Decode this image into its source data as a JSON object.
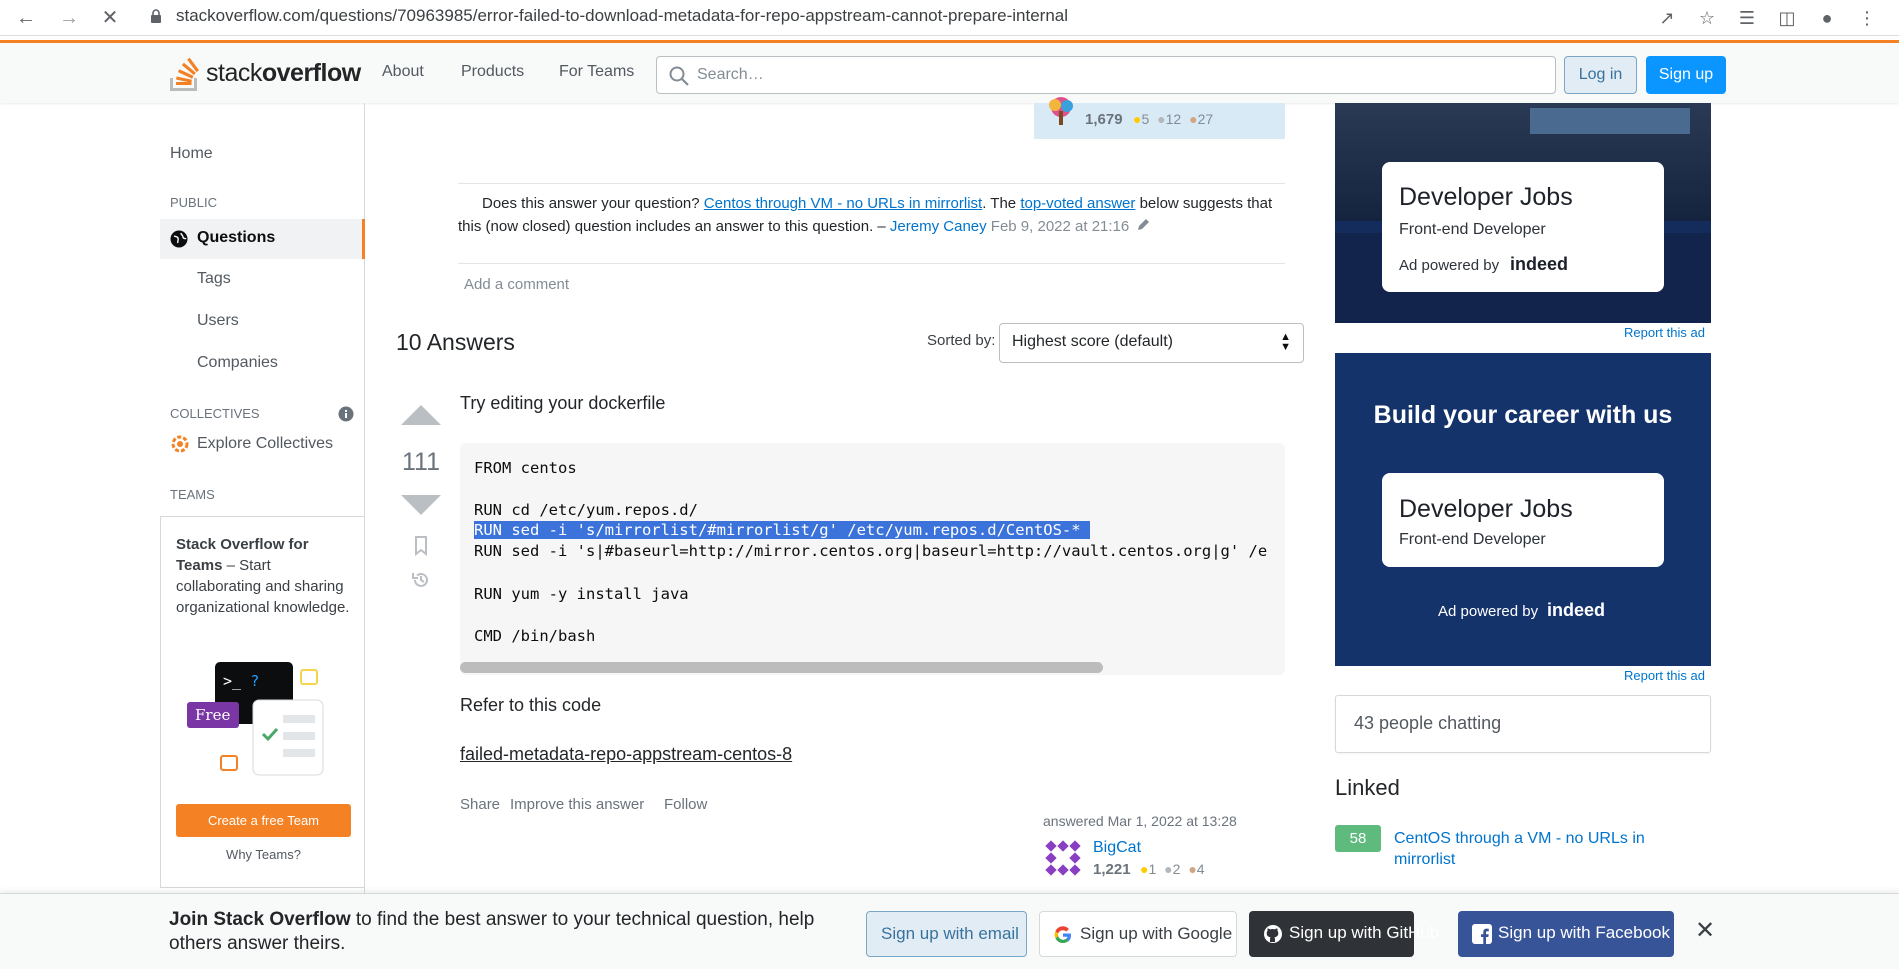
{
  "browser": {
    "url": "stackoverflow.com/questions/70963985/error-failed-to-download-metadata-for-repo-appstream-cannot-prepare-internal"
  },
  "header": {
    "logo_light": "stack",
    "logo_bold": "overflow",
    "nav": [
      "About",
      "Products",
      "For Teams"
    ],
    "search_placeholder": "Search…",
    "login": "Log in",
    "signup": "Sign up"
  },
  "sidebar": {
    "home": "Home",
    "public": "PUBLIC",
    "questions": "Questions",
    "tags": "Tags",
    "users": "Users",
    "companies": "Companies",
    "collectives": "COLLECTIVES",
    "explore_collectives": "Explore Collectives",
    "teams": "TEAMS",
    "teams_box": {
      "title": "Stack Overflow for Teams",
      "text": " – Start collaborating and sharing organizational knowledge.",
      "free_badge": "Free",
      "create_button": "Create a free Team",
      "why": "Why Teams?"
    }
  },
  "question_owner": {
    "rep": "1,679",
    "gold": "5",
    "silver": "12",
    "bronze": "27"
  },
  "comment": {
    "prefix": "Does this answer your question? ",
    "link1": "Centos through VM - no URLs in mirrorlist",
    "middle": ". The ",
    "link2": "top-voted answer",
    "suffix": " below suggests that this (now closed) question includes an answer to this question. – ",
    "author": "Jeremy Caney",
    "date": "Feb 9, 2022 at 21:16"
  },
  "add_comment": "Add a comment",
  "answers": {
    "title": "10 Answers",
    "sorted_label": "Sorted by:",
    "sort_value": "Highest score (default)"
  },
  "answer": {
    "votes": "111",
    "intro": "Try editing your dockerfile",
    "code_lines": [
      "FROM centos",
      "",
      "RUN cd /etc/yum.repos.d/",
      "RUN sed -i 's/mirrorlist/#mirrorlist/g' /etc/yum.repos.d/CentOS-* ",
      "RUN sed -i 's|#baseurl=http://mirror.centos.org|baseurl=http://vault.centos.org|g' /e",
      "",
      "RUN yum -y install java",
      "",
      "CMD /bin/bash"
    ],
    "refer": "Refer to this code",
    "link": "failed-metadata-repo-appstream-centos-8",
    "actions": [
      "Share",
      "Improve this answer",
      "Follow"
    ],
    "answered": "answered Mar 1, 2022 at 13:28",
    "author": "BigCat",
    "rep": "1,221",
    "gold": "1",
    "silver": "2",
    "bronze": "4"
  },
  "ads": {
    "ad1_title": "Developer Jobs",
    "ad1_sub": "Front-end Developer",
    "ad1_powered": "Ad powered by",
    "ad1_brand": "indeed",
    "ad2_heading": "Build your career with us",
    "ad2_title": "Developer Jobs",
    "ad2_sub": "Front-end Developer",
    "ad2_powered": "Ad powered by",
    "ad2_brand": "indeed",
    "report": "Report this ad"
  },
  "chat": "43 people chatting",
  "linked": {
    "title": "Linked",
    "count": "58",
    "item": "CentOS through a VM - no URLs in mirrorlist"
  },
  "banner": {
    "bold": "Join Stack Overflow",
    "text": " to find the best answer to your technical question, help others answer theirs.",
    "email": "Sign up with email",
    "google": "Sign up with Google",
    "github": "Sign up with GitHub",
    "facebook": "Sign up with Facebook"
  },
  "colors": {
    "accent": "#f48225",
    "link": "#0074cc",
    "primary_button": "#0a95ff",
    "ad_bg": "#142c5c"
  }
}
